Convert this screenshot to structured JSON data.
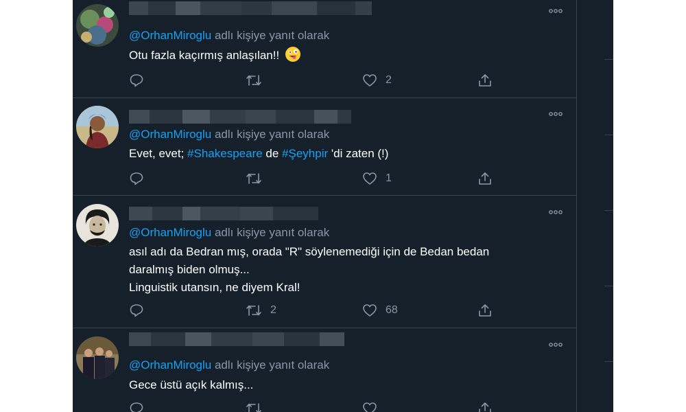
{
  "colors": {
    "background": "#15202b",
    "border": "#38444d",
    "text": "#ffffff",
    "secondary_text": "#8899a6",
    "link": "#1da1f2"
  },
  "tweets": [
    {
      "reply_prefix": "@OrhanMiroglu",
      "reply_suffix": " adlı kişiye yanıt olarak",
      "text_lines": [
        "Otu fazla kaçırmış anlaşılan!!"
      ],
      "emoji": "zany-face",
      "reply_count": "",
      "retweet_count": "",
      "like_count": "2"
    },
    {
      "reply_prefix": "@OrhanMiroglu",
      "reply_suffix": " adlı kişiye yanıt olarak",
      "text_parts": {
        "t1": "Evet, evet; ",
        "h1": "#Shakespeare",
        "t2": " de ",
        "h2": "#Şeyhpir",
        "t3": " 'di zaten (!)"
      },
      "reply_count": "",
      "retweet_count": "",
      "like_count": "1"
    },
    {
      "reply_prefix": "@OrhanMiroglu",
      "reply_suffix": " adlı kişiye yanıt olarak",
      "text_lines": [
        "asıl adı da Bedran mış, orada \"R\" söylenemediği için de Bedan bedan",
        "daralmış biden olmuş...",
        "Linguistik utansın, ne diyem Kral!"
      ],
      "reply_count": "",
      "retweet_count": "2",
      "like_count": "68"
    },
    {
      "reply_prefix": "@OrhanMiroglu",
      "reply_suffix": " adlı kişiye yanıt olarak",
      "text_lines": [
        "Gece üstü açık kalmış..."
      ],
      "reply_count": "",
      "retweet_count": "",
      "like_count": ""
    }
  ],
  "icons": {
    "more": "more-horizontal-icon",
    "reply": "reply-icon",
    "retweet": "retweet-icon",
    "like": "heart-icon",
    "share": "share-icon"
  }
}
